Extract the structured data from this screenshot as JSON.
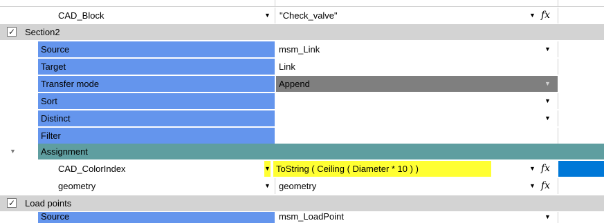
{
  "rows": {
    "top_partial": {
      "label": "CAD_Block",
      "value": "\"Check_valve\""
    },
    "section2": {
      "label": "Section2",
      "checked": "✓"
    },
    "source": {
      "label": "Source",
      "value": "msm_Link"
    },
    "target": {
      "label": "Target",
      "value": "Link"
    },
    "transfer_mode": {
      "label": "Transfer mode",
      "value": "Append"
    },
    "sort": {
      "label": "Sort",
      "value": ""
    },
    "distinct": {
      "label": "Distinct",
      "value": ""
    },
    "filter": {
      "label": "Filter",
      "value": ""
    },
    "assignment": {
      "label": "Assignment"
    },
    "cad_color": {
      "label": "CAD_ColorIndex",
      "value": "ToString (  Ceiling ( Diameter * 10 )  )"
    },
    "geometry": {
      "label": "geometry",
      "value": "geometry"
    },
    "load_points": {
      "label": "Load points",
      "checked": "✓"
    },
    "source2": {
      "label": "Source",
      "value": "msm_LoadPoint"
    }
  },
  "icons": {
    "dropdown": "▼",
    "fx": "fx",
    "checkbox_mark": "✓",
    "expander": "▼"
  },
  "colors": {
    "property_blue": "#6495ed",
    "section_grey": "#d3d3d3",
    "assignment_teal": "#5f9ea0",
    "dark_grey": "#7f7f7f",
    "highlight_yellow": "#ffff33",
    "selected_blue": "#0078d7"
  }
}
